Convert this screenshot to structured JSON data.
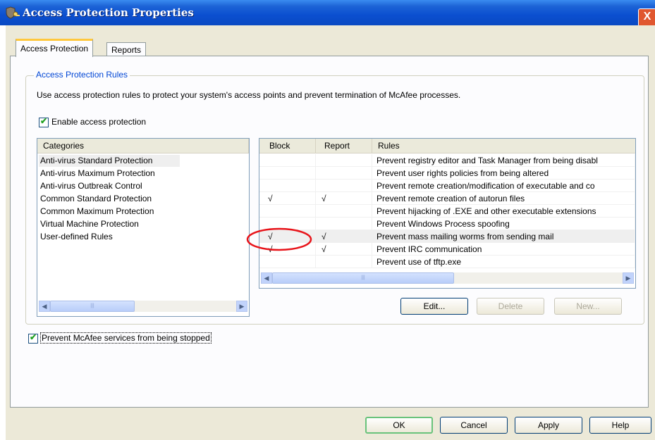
{
  "window": {
    "title": "Access Protection Properties",
    "close_glyph": "X"
  },
  "tabs": [
    {
      "label": "Access Protection",
      "active": true
    },
    {
      "label": "Reports",
      "active": false
    }
  ],
  "group": {
    "legend": "Access Protection Rules",
    "description": "Use access protection rules to protect your system's access points and prevent termination of McAfee processes.",
    "enable_label": "Enable access protection",
    "enable_checked": true
  },
  "categories": {
    "header": "Categories",
    "items": [
      "Anti-virus Standard Protection",
      "Anti-virus Maximum Protection",
      "Anti-virus Outbreak Control",
      "Common Standard Protection",
      "Common Maximum Protection",
      "Virtual Machine Protection",
      "User-defined Rules"
    ],
    "selected_index": 0
  },
  "rules": {
    "headers": {
      "block": "Block",
      "report": "Report",
      "rules": "Rules"
    },
    "rows": [
      {
        "block": "",
        "report": "",
        "rule": "Prevent registry editor and Task Manager from being disabl"
      },
      {
        "block": "",
        "report": "",
        "rule": "Prevent user rights policies from being altered"
      },
      {
        "block": "",
        "report": "",
        "rule": "Prevent remote creation/modification of executable and co"
      },
      {
        "block": "√",
        "report": "√",
        "rule": "Prevent remote creation of autorun files"
      },
      {
        "block": "",
        "report": "",
        "rule": "Prevent hijacking of .EXE and other executable extensions"
      },
      {
        "block": "",
        "report": "",
        "rule": "Prevent Windows Process spoofing"
      },
      {
        "block": "√",
        "report": "√",
        "rule": "Prevent mass mailing worms from sending mail"
      },
      {
        "block": "√",
        "report": "√",
        "rule": "Prevent IRC communication"
      },
      {
        "block": "",
        "report": "",
        "rule": "Prevent use of tftp.exe"
      }
    ],
    "highlight_row": 6
  },
  "rule_buttons": {
    "edit": "Edit...",
    "delete": "Delete",
    "new": "New..."
  },
  "prevent_services": {
    "label": "Prevent McAfee services from being stopped",
    "checked": true
  },
  "dialog_buttons": {
    "ok": "OK",
    "cancel": "Cancel",
    "apply": "Apply",
    "help": "Help"
  },
  "colors": {
    "titlebar": "#0b4fd0",
    "accent_legend": "#0046d5",
    "annotation": "#e8141a"
  },
  "icons": {
    "app": "shield-key-icon",
    "close": "close-icon",
    "scroll_left": "scroll-left-icon",
    "scroll_right": "scroll-right-icon"
  }
}
